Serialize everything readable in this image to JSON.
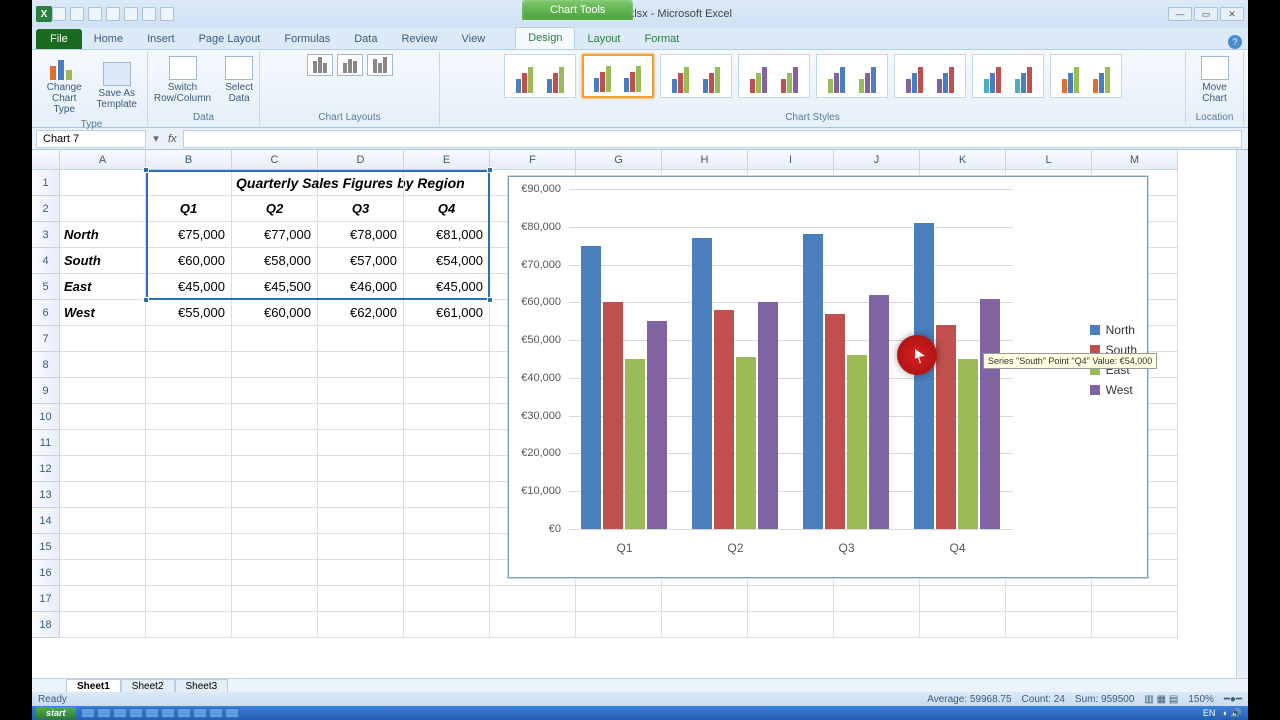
{
  "title": "HowToBarChart.xlsx - Microsoft Excel",
  "chart_tools_label": "Chart Tools",
  "tabs": {
    "file": "File",
    "list": [
      "Home",
      "Insert",
      "Page Layout",
      "Formulas",
      "Data",
      "Review",
      "View"
    ],
    "context": [
      "Design",
      "Layout",
      "Format"
    ],
    "active": "Design"
  },
  "ribbon": {
    "groups": {
      "type": "Type",
      "data": "Data",
      "layouts": "Chart Layouts",
      "styles": "Chart Styles",
      "location": "Location"
    },
    "type_btns": {
      "change": "Change Chart Type",
      "save": "Save As Template"
    },
    "data_btns": {
      "switch": "Switch Row/Column",
      "select": "Select Data"
    },
    "location_btn": "Move Chart"
  },
  "namebox": "Chart 7",
  "columns": [
    "A",
    "B",
    "C",
    "D",
    "E",
    "F",
    "G",
    "H",
    "I",
    "J",
    "K",
    "L",
    "M"
  ],
  "rows": [
    1,
    2,
    3,
    4,
    5,
    6,
    7,
    8,
    9,
    10,
    11,
    12,
    13,
    14,
    15,
    16,
    17,
    18
  ],
  "table": {
    "title": "Quarterly Sales Figures by Region",
    "quarters": [
      "Q1",
      "Q2",
      "Q3",
      "Q4"
    ],
    "regions": [
      "North",
      "South",
      "East",
      "West"
    ],
    "cells": {
      "North": [
        "€75,000",
        "€77,000",
        "€78,000",
        "€81,000"
      ],
      "South": [
        "€60,000",
        "€58,000",
        "€57,000",
        "€54,000"
      ],
      "East": [
        "€45,000",
        "€45,500",
        "€46,000",
        "€45,000"
      ],
      "West": [
        "€55,000",
        "€60,000",
        "€62,000",
        "€61,000"
      ]
    }
  },
  "chart_data": {
    "type": "bar",
    "categories": [
      "Q1",
      "Q2",
      "Q3",
      "Q4"
    ],
    "series": [
      {
        "name": "North",
        "values": [
          75000,
          77000,
          78000,
          81000
        ],
        "color": "#4a7ebc"
      },
      {
        "name": "South",
        "values": [
          60000,
          58000,
          57000,
          54000
        ],
        "color": "#bf504d"
      },
      {
        "name": "East",
        "values": [
          45000,
          45500,
          46000,
          45000
        ],
        "color": "#9bbb59"
      },
      {
        "name": "West",
        "values": [
          55000,
          60000,
          62000,
          61000
        ],
        "color": "#8064a2"
      }
    ],
    "ylim": [
      0,
      90000
    ],
    "yticks": [
      "€0",
      "€10,000",
      "€20,000",
      "€30,000",
      "€40,000",
      "€50,000",
      "€60,000",
      "€70,000",
      "€80,000",
      "€90,000"
    ],
    "tooltip": "Series \"South\" Point \"Q4\" Value: €54,000"
  },
  "sheets": [
    "Sheet1",
    "Sheet2",
    "Sheet3"
  ],
  "status": {
    "ready": "Ready",
    "average": "Average: 59968.75",
    "count": "Count: 24",
    "sum": "Sum: 959500",
    "zoom": "150%"
  },
  "taskbar": {
    "start": "start",
    "time": ""
  }
}
